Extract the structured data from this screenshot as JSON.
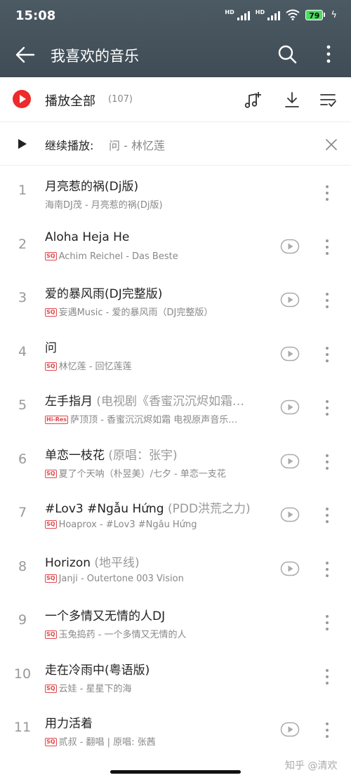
{
  "status": {
    "time": "15:08",
    "network1": "HD",
    "network2": "HD",
    "battery": "79"
  },
  "header": {
    "title": "我喜欢的音乐"
  },
  "play_all": {
    "label": "播放全部",
    "count": "(107)"
  },
  "resume": {
    "label": "继续播放:",
    "track": "问 - 林忆莲"
  },
  "songs": [
    {
      "num": "1",
      "title": "月亮惹的祸(Dj版)",
      "title_extra": "",
      "badge": "",
      "subtitle": "海南DJ茂 - 月亮惹的祸(Dj版)",
      "has_mv": false
    },
    {
      "num": "2",
      "title": "Aloha Heja He",
      "title_extra": "",
      "badge": "SQ",
      "subtitle": "Achim Reichel - Das Beste",
      "has_mv": true
    },
    {
      "num": "3",
      "title": "爱的暴风雨(DJ完整版)",
      "title_extra": "",
      "badge": "SQ",
      "subtitle": "妄遇Music - 爱的暴风雨（DJ完整版）",
      "has_mv": true
    },
    {
      "num": "4",
      "title": "问",
      "title_extra": "",
      "badge": "SQ",
      "subtitle": "林忆莲 - 回忆莲莲",
      "has_mv": true
    },
    {
      "num": "5",
      "title": "左手指月",
      "title_extra": "(电视剧《香蜜沉沉烬如霜…",
      "badge": "Hi-Res",
      "subtitle": "萨顶顶 - 香蜜沉沉烬如霜 电视原声音乐…",
      "has_mv": true
    },
    {
      "num": "6",
      "title": "单恋一枝花",
      "title_extra": "(原唱：张宇)",
      "badge": "SQ",
      "subtitle": "夏了个天呐（朴昱美）/七夕 - 单恋一支花",
      "has_mv": true
    },
    {
      "num": "7",
      "title": "#Lov3 #Ngẫu Hứng",
      "title_extra": "(PDD洪荒之力)",
      "badge": "SQ",
      "subtitle": "Hoaprox - #Lov3 #Ngẫu Hứng",
      "has_mv": true
    },
    {
      "num": "8",
      "title": "Horizon",
      "title_extra": "(地平线)",
      "badge": "SQ",
      "subtitle": "Janji - Outertone 003   Vision",
      "has_mv": true
    },
    {
      "num": "9",
      "title": "一个多情又无情的人DJ",
      "title_extra": "",
      "badge": "SQ",
      "subtitle": "玉兔捣药 - 一个多情又无情的人",
      "has_mv": false
    },
    {
      "num": "10",
      "title": "走在冷雨中(粤语版)",
      "title_extra": "",
      "badge": "SQ",
      "subtitle": "云娃 - 星星下的海",
      "has_mv": false
    },
    {
      "num": "11",
      "title": "用力活着",
      "title_extra": "",
      "badge": "SQ",
      "subtitle": "贰叔 - 翻唱 | 原唱: 张茜",
      "has_mv": true
    }
  ],
  "watermark": "知乎 @清欢",
  "colors": {
    "header_bg": "#445159",
    "accent_red": "#ee2a2a",
    "badge_red": "#e0474c"
  }
}
